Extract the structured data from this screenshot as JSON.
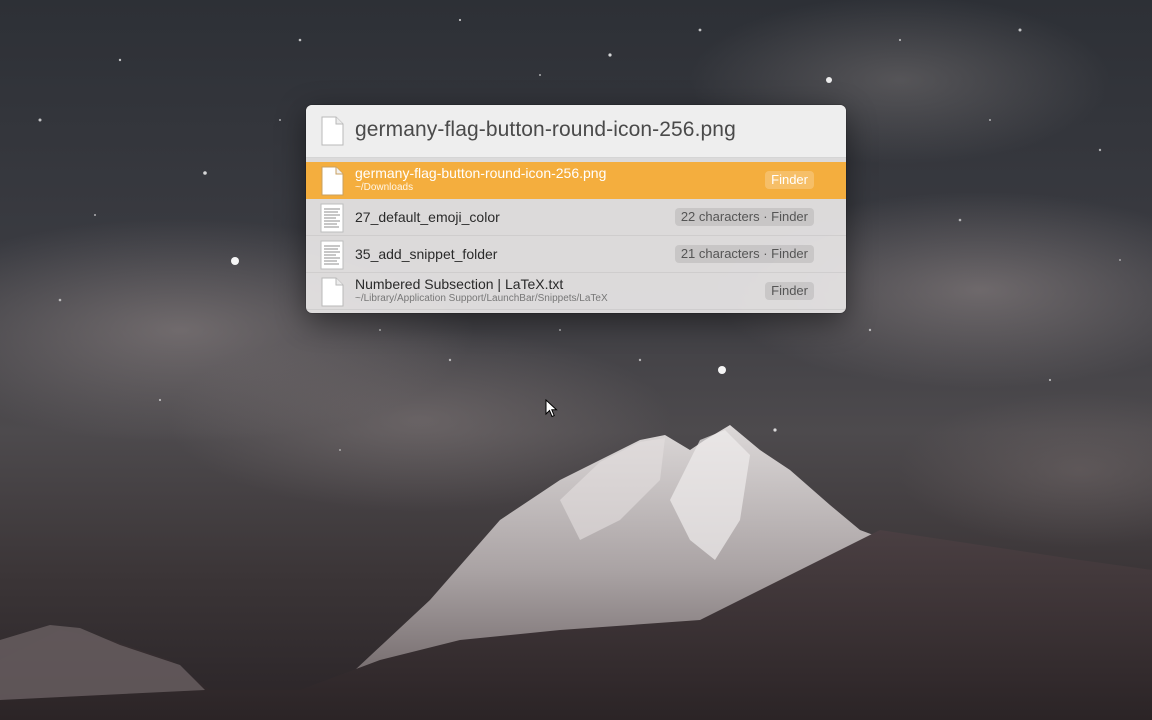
{
  "query": {
    "text": "germany-flag-button-round-icon-256.png",
    "icon": "document-icon"
  },
  "results": [
    {
      "title": "germany-flag-button-round-icon-256.png",
      "subtitle": "~/Downloads",
      "tag": "Finder",
      "icon": "document-icon",
      "selected": true
    },
    {
      "title": "27_default_emoji_color",
      "tag": "22 characters · Finder",
      "icon": "text-document-icon",
      "selected": false
    },
    {
      "title": "35_add_snippet_folder",
      "tag": "21 characters · Finder",
      "icon": "text-document-icon",
      "selected": false
    },
    {
      "title": "Numbered Subsection | LaTeX.txt",
      "subtitle": "~/Library/Application Support/LaunchBar/Snippets/LaTeX",
      "tag": "Finder",
      "icon": "document-icon",
      "selected": false
    }
  ],
  "colors": {
    "selection": "#f4ae3e",
    "panel": "#e8e6e6"
  }
}
